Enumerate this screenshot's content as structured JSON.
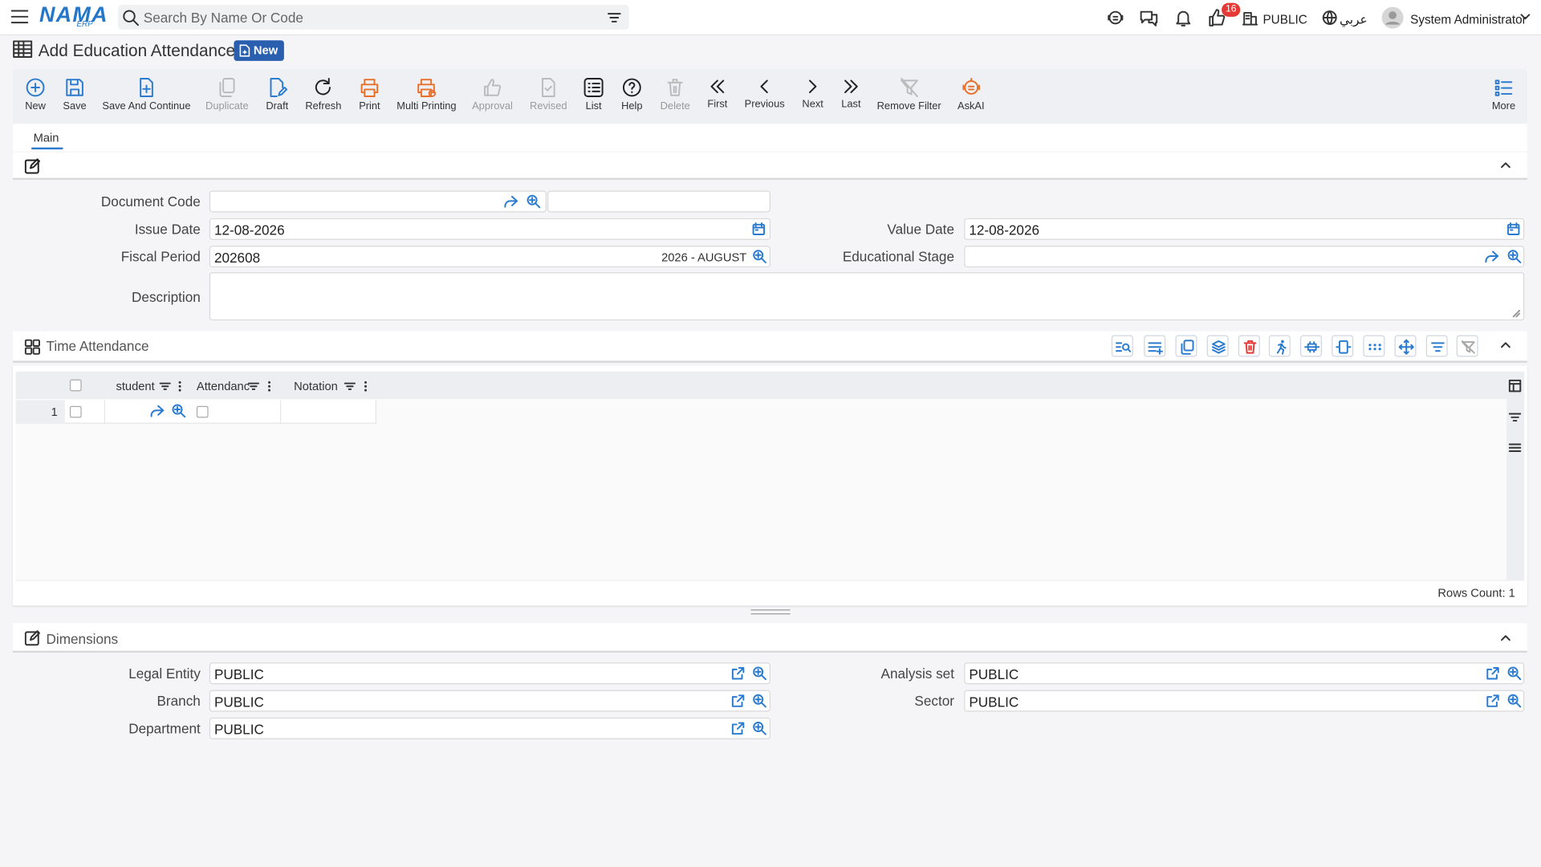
{
  "header": {
    "logo_main": "NAMA",
    "logo_sub": "ERP",
    "search_placeholder": "Search By Name Or Code",
    "notification_count": "16",
    "company": "PUBLIC",
    "language": "عربي",
    "user": "System Administrator"
  },
  "page": {
    "title": "Add Education Attendance",
    "badge": "New"
  },
  "toolbar": {
    "new": "New",
    "save": "Save",
    "save_continue": "Save And Continue",
    "duplicate": "Duplicate",
    "draft": "Draft",
    "refresh": "Refresh",
    "print": "Print",
    "multi_printing": "Multi Printing",
    "approval": "Approval",
    "revised": "Revised",
    "list": "List",
    "help": "Help",
    "delete": "Delete",
    "first": "First",
    "previous": "Previous",
    "next": "Next",
    "last": "Last",
    "remove_filter": "Remove Filter",
    "askai": "AskAI",
    "more": "More"
  },
  "tabs": {
    "main": "Main"
  },
  "form": {
    "document_code_label": "Document Code",
    "document_code_value": "",
    "issue_date_label": "Issue Date",
    "issue_date_value": "12-08-2026",
    "value_date_label": "Value Date",
    "value_date_value": "12-08-2026",
    "fiscal_period_label": "Fiscal Period",
    "fiscal_period_value": "202608",
    "fiscal_period_name": "2026 - AUGUST",
    "educational_stage_label": "Educational Stage",
    "educational_stage_value": "",
    "description_label": "Description",
    "description_value": ""
  },
  "attendance": {
    "section_title": "Time Attendance",
    "columns": {
      "student": "student",
      "attendance": "Attendanc",
      "notation": "Notation"
    },
    "rows": [
      {
        "index": "1",
        "student": "",
        "notation": ""
      }
    ],
    "rows_count_label": "Rows Count: 1"
  },
  "dimensions": {
    "section_title": "Dimensions",
    "legal_entity_label": "Legal Entity",
    "legal_entity_value": "PUBLIC",
    "analysis_set_label": "Analysis set",
    "analysis_set_value": "PUBLIC",
    "branch_label": "Branch",
    "branch_value": "PUBLIC",
    "sector_label": "Sector",
    "sector_value": "PUBLIC",
    "department_label": "Department",
    "department_value": "PUBLIC"
  },
  "colors": {
    "accent": "#2a7bd0",
    "badge": "#2a5fb0",
    "print": "#e8702a",
    "danger": "#e53935"
  }
}
